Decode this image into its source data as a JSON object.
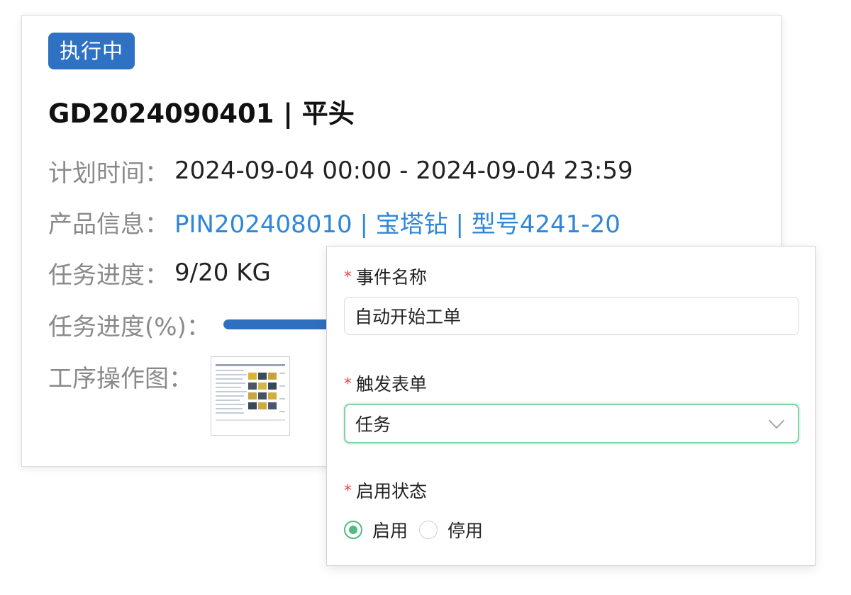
{
  "task": {
    "status": "执行中",
    "title": "GD2024090401 | 平头",
    "plan_time_label": "计划时间：",
    "plan_time_value": "2024-09-04 00:00 - 2024-09-04 23:59",
    "product_label": "产品信息：",
    "product_value": "PIN202408010 | 宝塔钻 | 型号4241-20",
    "progress_label": "任务进度：",
    "progress_value": "9/20 KG",
    "progress_pct_label": "任务进度(%)：",
    "progress_fraction": 0.45,
    "diagram_label": "工序操作图："
  },
  "event_form": {
    "event_name_label": "事件名称",
    "event_name_value": "自动开始工单",
    "trigger_form_label": "触发表单",
    "trigger_form_value": "任务",
    "enable_status_label": "启用状态",
    "options": [
      {
        "label": "启用",
        "checked": true
      },
      {
        "label": "停用",
        "checked": false
      }
    ],
    "required_mark": "*"
  },
  "colors": {
    "status_badge": "#2f72c4",
    "link": "#2f86d8",
    "progress_fill": "#2f6fbf",
    "radio_checked": "#55b983",
    "select_focus_border": "#7fd3a1",
    "required_mark": "#e0474c"
  },
  "icons": {
    "select_arrow": "chevron-down-icon",
    "thumbnail": "process-diagram-thumbnail"
  }
}
